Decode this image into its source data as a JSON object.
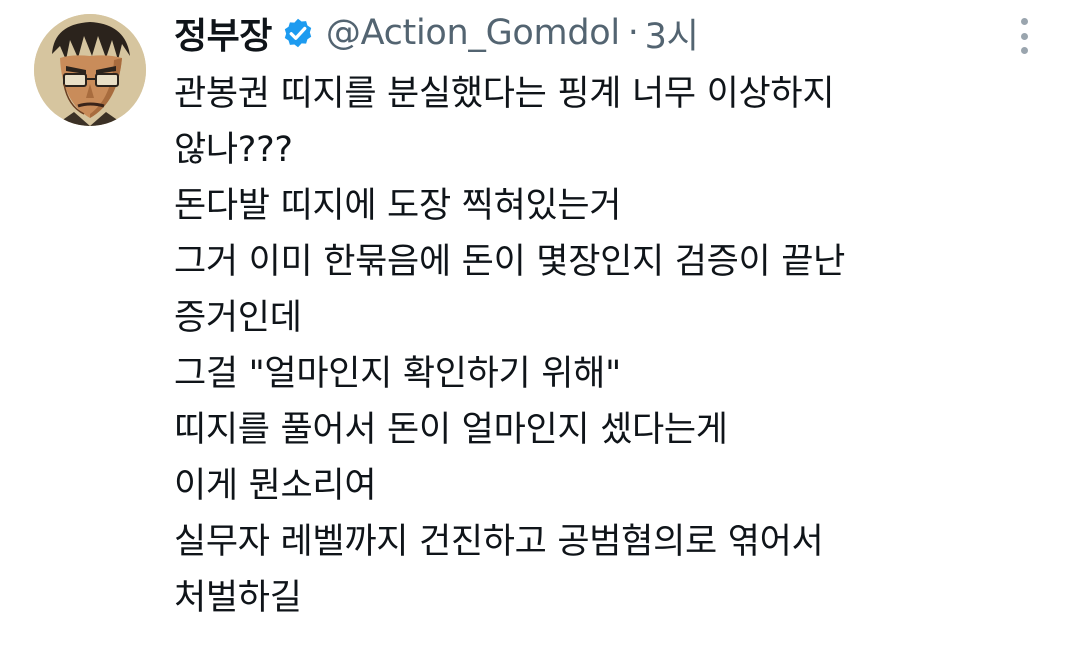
{
  "tweet": {
    "author": {
      "display_name": "정부장",
      "handle": "@Action_Gomdol",
      "verified_icon": "verified-badge-icon",
      "avatar_icon": "avatar-illustration"
    },
    "separator": "·",
    "time": "3시",
    "more_icon": "more-vertical-icon",
    "lines": [
      "관봉권 띠지를 분실했다는 핑계 너무 이상하지",
      "않나???",
      "돈다발 띠지에 도장 찍혀있는거",
      "그거 이미 한묶음에 돈이 몇장인지 검증이 끝난",
      "증거인데",
      "그걸 \"얼마인지 확인하기 위해\"",
      "띠지를 풀어서 돈이 얼마인지 셌다는게",
      "이게 뭔소리여",
      "실무자 레벨까지 건진하고 공범혐의로 엮어서",
      "처벌하길"
    ]
  },
  "colors": {
    "text": "#0f1419",
    "secondary": "#536471",
    "verified": "#1d9bf0"
  }
}
